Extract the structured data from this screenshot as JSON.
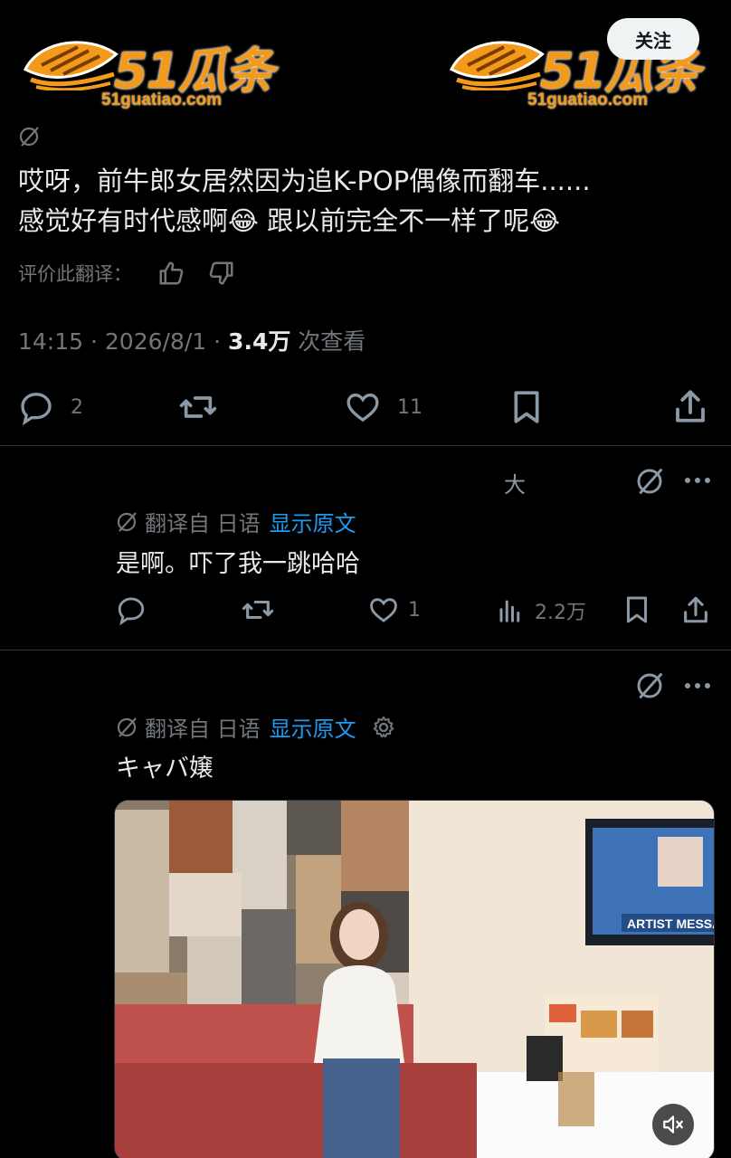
{
  "watermark": {
    "brand": "51瓜条",
    "domain": "51guatiao.com",
    "accent_color": "#f39a1a"
  },
  "header": {
    "follow_label": "关注"
  },
  "tweet": {
    "text_line1": "哎呀，前牛郎女居然因为追K-POP偶像而翻车......",
    "text_line2_a": "感觉好有时代感啊",
    "emoji1": "😂",
    "text_line2_b": " 跟以前完全不一样了呢",
    "emoji2": "😂",
    "rate_label": "评价此翻译：",
    "time": "14:15",
    "sep": "·",
    "date": "2026/8/1",
    "views_count": "3.4万",
    "views_label": " 次查看",
    "reply_count": "2",
    "like_count": "11"
  },
  "reply1": {
    "translated_from": "翻译自 日语",
    "show_original": "显示原文",
    "text": "是啊。吓了我一跳哈哈",
    "like_count": "1",
    "views_count": "2.2万",
    "partial_glyph": "大"
  },
  "reply2": {
    "translated_from": "翻译自 日语",
    "show_original": "显示原文",
    "text": "キャバ嬢",
    "tv_text": "ARTIST MESSA"
  },
  "icons": [
    "globe-slash-icon",
    "like-icon",
    "dislike-icon",
    "reply-icon",
    "retweet-icon",
    "heart-icon",
    "bookmark-icon",
    "share-icon",
    "more-icon",
    "views-icon",
    "gear-icon",
    "mute-icon"
  ],
  "colors": {
    "background": "#000000",
    "text": "#e7e9ea",
    "muted": "#71767b",
    "link": "#1d9bf0",
    "divider": "#2f3336"
  }
}
